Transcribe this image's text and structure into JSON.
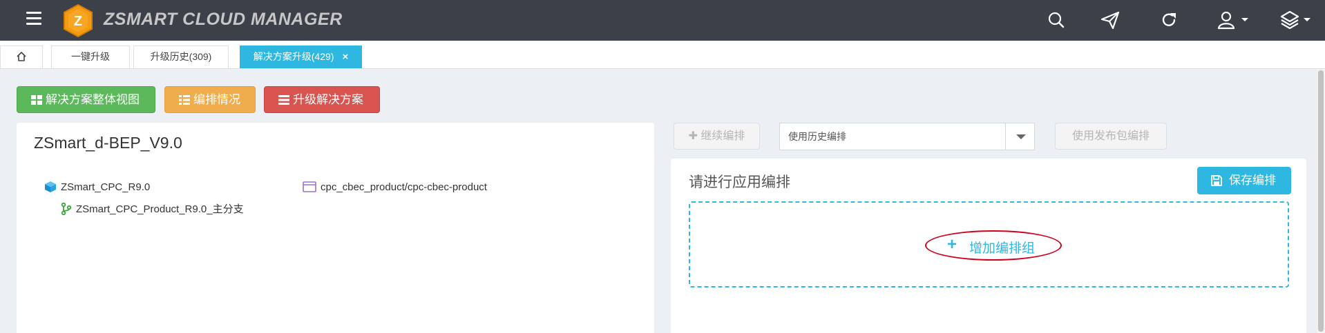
{
  "header": {
    "brand": "ZSMART CLOUD MANAGER",
    "logo_letter": "Z",
    "icons": [
      "menu-icon",
      "search-icon",
      "send-icon",
      "refresh-icon",
      "user-icon",
      "layers-icon"
    ]
  },
  "tabs": [
    {
      "label": ""
    },
    {
      "label": "一键升级"
    },
    {
      "label": "升级历史(309)"
    },
    {
      "label": "解决方案升级(429)",
      "close": "×"
    }
  ],
  "actions": {
    "overview": "解决方案整体视图",
    "arrangement": "编排情况",
    "upgrade": "升级解决方案"
  },
  "solution": {
    "title": "ZSmart_d-BEP_V9.0",
    "nodes": {
      "product": "ZSmart_CPC_R9.0",
      "branch": "ZSmart_CPC_Product_R9.0_主分支",
      "repo": "cpc_cbec_product/cpc-cbec-product"
    }
  },
  "arrange": {
    "continue": "继续编排",
    "history_select": "使用历史编排",
    "use_release": "使用发布包编排",
    "title": "请进行应用编排",
    "save": "保存编排",
    "add_group": "增加编排组"
  },
  "colors": {
    "topbar": "#3c4048",
    "accent": "#2eb7e1",
    "green": "#5bb85b",
    "orange": "#f0ad4e",
    "red": "#d9534f",
    "highlight": "#d0021b"
  }
}
